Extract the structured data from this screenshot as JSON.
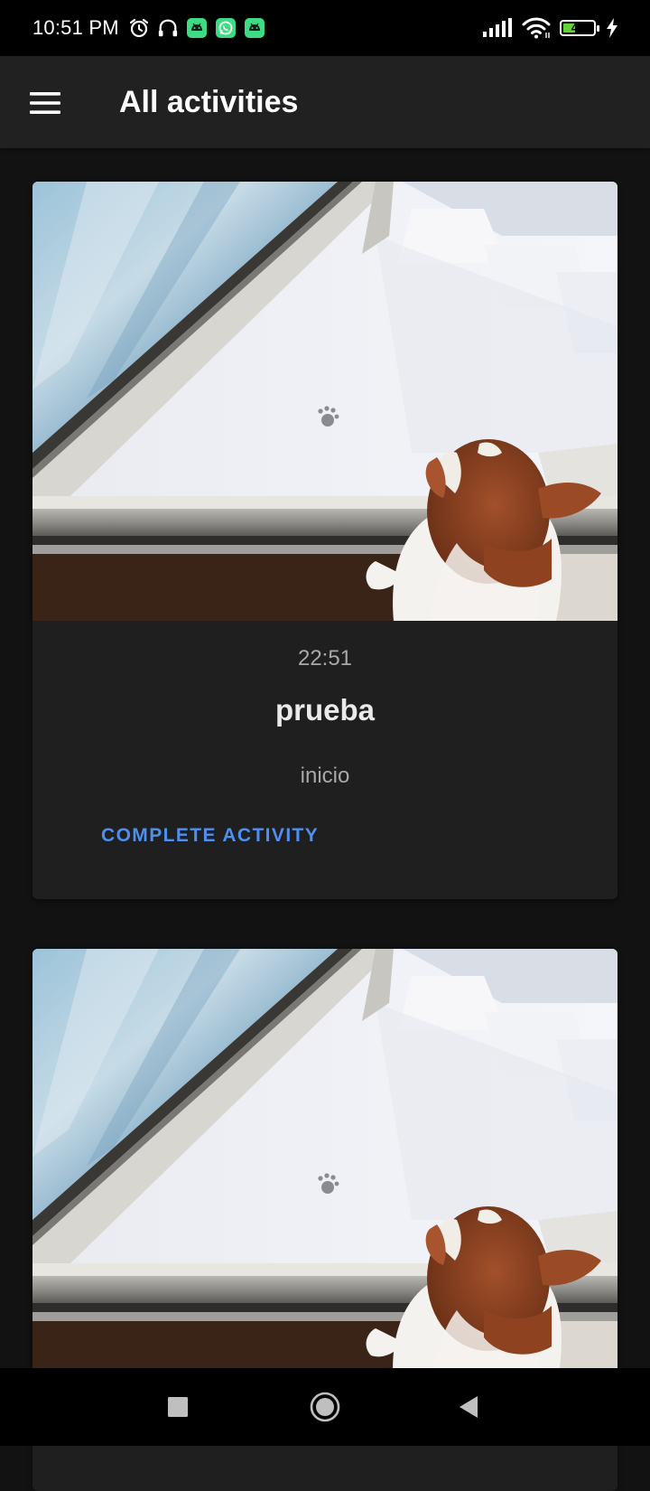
{
  "status_bar": {
    "time": "10:51 PM",
    "battery_level": "40",
    "battery_fraction": 0.4,
    "left_icons": [
      "alarm-icon",
      "headset-icon",
      "android-app-icon",
      "whatsapp-icon",
      "android-app-icon"
    ],
    "right_icons": [
      "signal-icon",
      "wifi-icon",
      "battery-icon",
      "charging-icon"
    ]
  },
  "app_bar": {
    "menu_icon": "hamburger-menu-icon",
    "title": "All activities"
  },
  "activities": [
    {
      "time": "22:51",
      "title": "prueba",
      "subtitle": "inicio",
      "action_label": "COMPLETE ACTIVITY"
    },
    {
      "time": "",
      "title": "",
      "subtitle": "",
      "action_label": ""
    }
  ],
  "nav_bar": {
    "icons": [
      "recents-square-icon",
      "home-circle-icon",
      "back-triangle-icon"
    ]
  },
  "colors": {
    "background": "#121212",
    "app_bar": "#212121",
    "card": "#1f1f1f",
    "accent": "#4f8ff0",
    "battery_fill": "#64d33a",
    "app_icon_green": "#3ddc84"
  }
}
